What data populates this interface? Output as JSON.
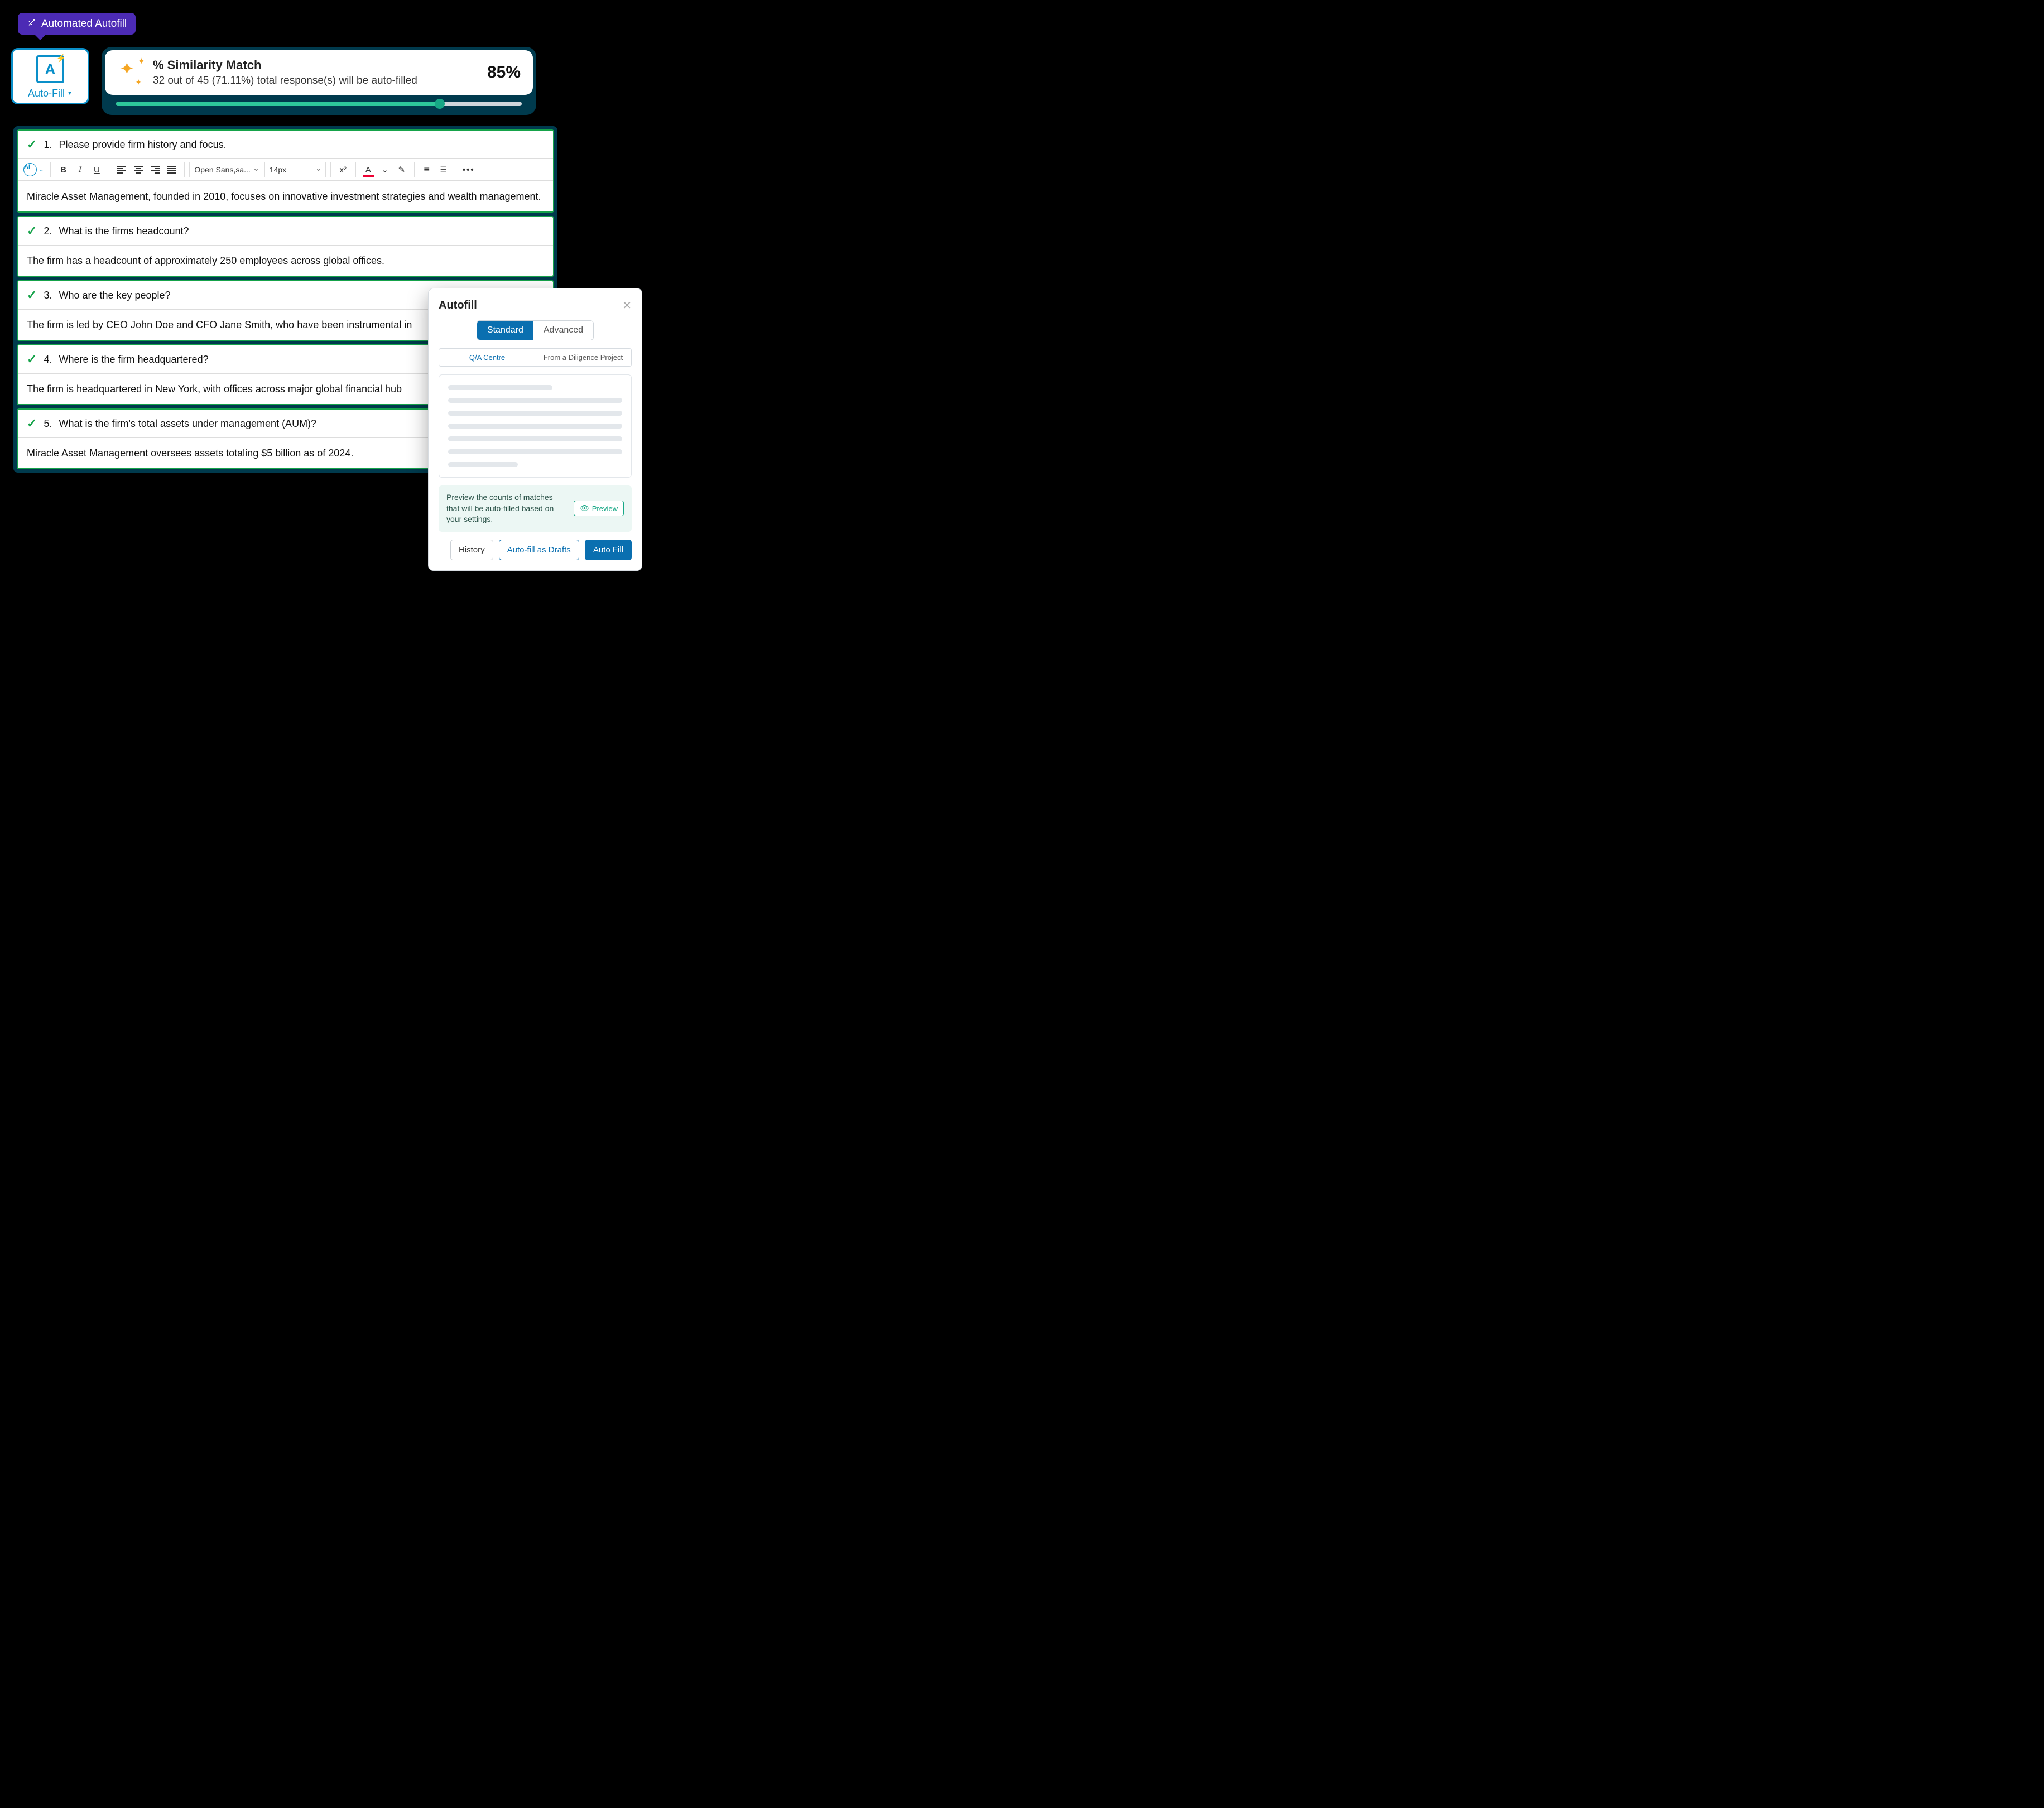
{
  "tooltip": {
    "label": "Automated Autofill"
  },
  "autofill_button": {
    "label": "Auto-Fill"
  },
  "similarity": {
    "title": "% Similarity Match",
    "subtitle": "32 out of 45 (71.11%) total response(s) will be auto-filled",
    "percent": "85%",
    "fill_pct": 80
  },
  "toolbar": {
    "font": "Open Sans,sa...",
    "size": "14px"
  },
  "questions": [
    {
      "num": "1.",
      "text": "Please provide firm history and focus.",
      "answer": "Miracle Asset Management, founded in 2010, focuses on innovative investment strategies and wealth management.",
      "rich": true
    },
    {
      "num": "2.",
      "text": "What is the firms headcount?",
      "answer": "The firm has a headcount of approximately 250 employees across global offices."
    },
    {
      "num": "3.",
      "text": "Who are the key people?",
      "answer": "The firm is led by CEO John Doe and CFO Jane Smith, who have been instrumental in"
    },
    {
      "num": "4.",
      "text": "Where is the firm headquartered?",
      "answer": "The firm is headquartered in New York, with offices across major global financial hub"
    },
    {
      "num": "5.",
      "text": "What is the firm's total assets under management (AUM)?",
      "answer": "Miracle Asset Management oversees assets totaling $5 billion as of 2024."
    }
  ],
  "panel": {
    "title": "Autofill",
    "tabs": {
      "standard": "Standard",
      "advanced": "Advanced"
    },
    "subtabs": {
      "qa": "Q/A Centre",
      "diligence": "From a Diligence Project"
    },
    "preview_msg": "Preview the counts of matches that will be auto-filled based on your settings.",
    "preview_btn": "Preview",
    "history": "History",
    "drafts": "Auto-fill as Drafts",
    "autofill": "Auto Fill"
  }
}
